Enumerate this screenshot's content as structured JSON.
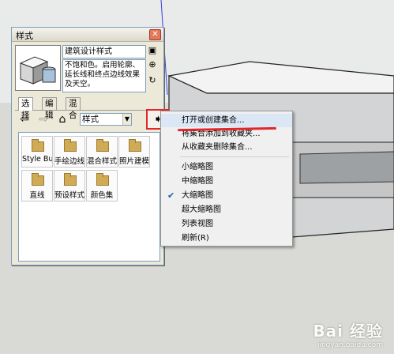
{
  "panel": {
    "title": "样式",
    "close_icon": "close-icon",
    "style_name": "建筑设计样式",
    "style_description": "不饱和色。启用轮廓、延长线和终点边线效果及天空。",
    "tabs": [
      {
        "label": "选择",
        "active": true
      },
      {
        "label": "编辑",
        "active": false
      },
      {
        "label": "混合",
        "active": false
      }
    ],
    "nav": {
      "back_icon": "back-arrow-icon",
      "forward_icon": "forward-arrow-icon",
      "home_icon": "home-icon",
      "collection_selected": "样式",
      "details_icon": "details-arrow-icon"
    },
    "folders": [
      {
        "label": "Style Buil"
      },
      {
        "label": "手绘边线"
      },
      {
        "label": "混合样式"
      },
      {
        "label": "照片建模"
      },
      {
        "label": "直线"
      },
      {
        "label": "预设样式"
      },
      {
        "label": "颜色集"
      }
    ]
  },
  "menu": {
    "items": [
      {
        "label": "打开或创建集合...",
        "highlight": true,
        "checked": false
      },
      {
        "label": "将集合添加到收藏夹...",
        "highlight": false,
        "checked": false
      },
      {
        "label": "从收藏夹删除集合...",
        "highlight": false,
        "checked": false
      },
      {
        "label": "小缩略图",
        "highlight": false,
        "checked": false
      },
      {
        "label": "中缩略图",
        "highlight": false,
        "checked": false
      },
      {
        "label": "大缩略图",
        "highlight": false,
        "checked": true
      },
      {
        "label": "超大缩略图",
        "highlight": false,
        "checked": false
      },
      {
        "label": "列表视图",
        "highlight": false,
        "checked": false
      },
      {
        "label": "刷新(R)",
        "highlight": false,
        "checked": false
      }
    ]
  },
  "watermark": {
    "main": "Bai 经验",
    "sub": "jingyan.baidu.com"
  },
  "colors": {
    "accent": "#e2262a",
    "menu_highlight": "#dce7f5"
  }
}
